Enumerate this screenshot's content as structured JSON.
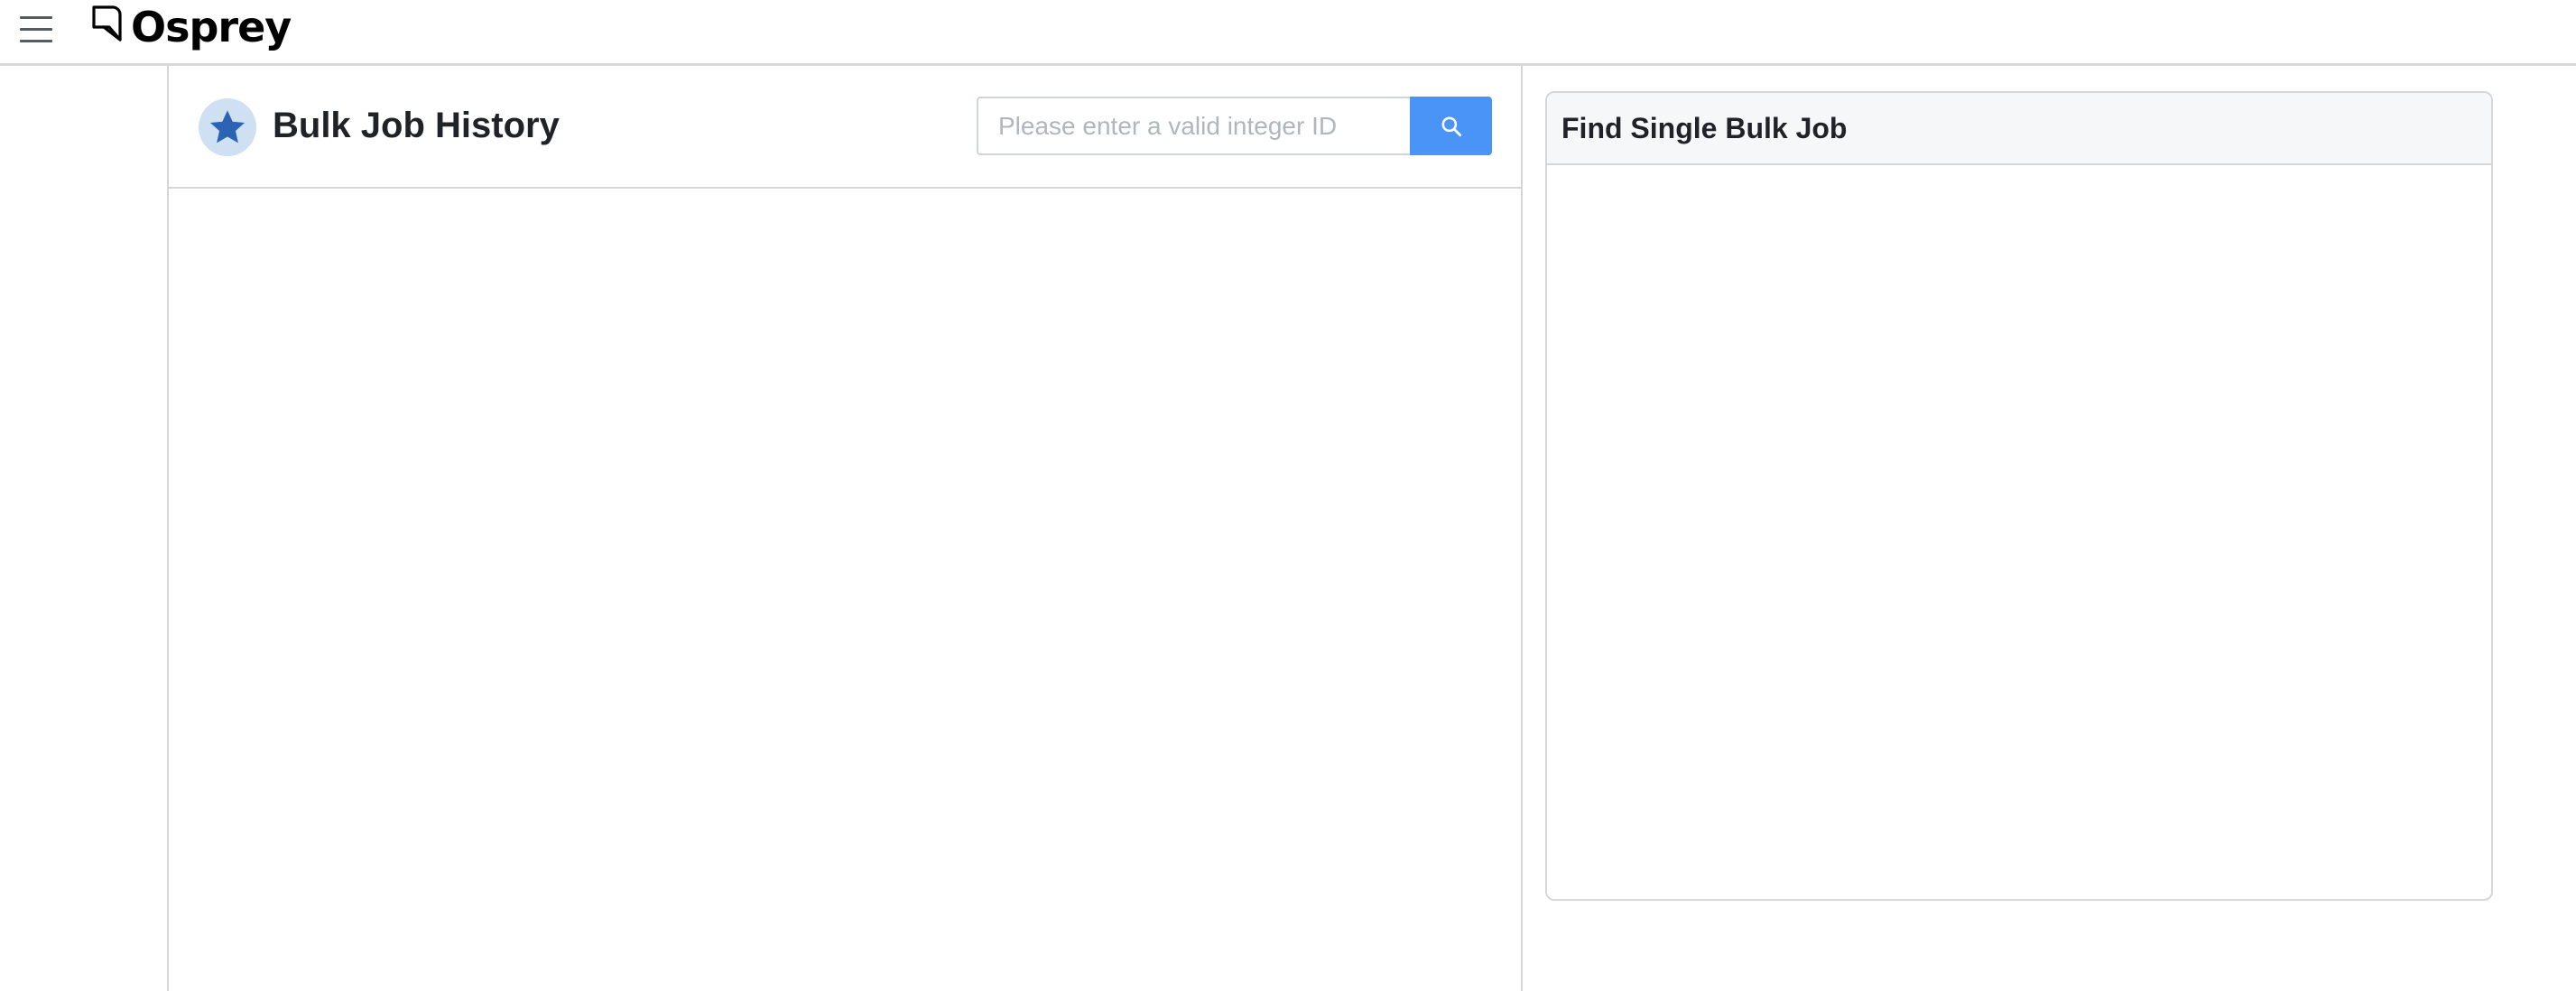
{
  "app": {
    "brand_name": "Osprey"
  },
  "header": {
    "menu_icon": "hamburger-menu-icon",
    "logo_icon": "osprey-logo-icon"
  },
  "main": {
    "title": "Bulk Job History",
    "title_icon": "star-icon",
    "search": {
      "placeholder": "Please enter a valid integer ID",
      "value": "",
      "button_icon": "search-icon"
    }
  },
  "side_card": {
    "title": "Find Single Bulk Job"
  },
  "colors": {
    "accent": "#4a93f7",
    "star": "#2b63b5",
    "star_badge_bg": "#cfe0f3",
    "border": "#d6d6d6",
    "card_header_bg": "#f6f7f9"
  }
}
